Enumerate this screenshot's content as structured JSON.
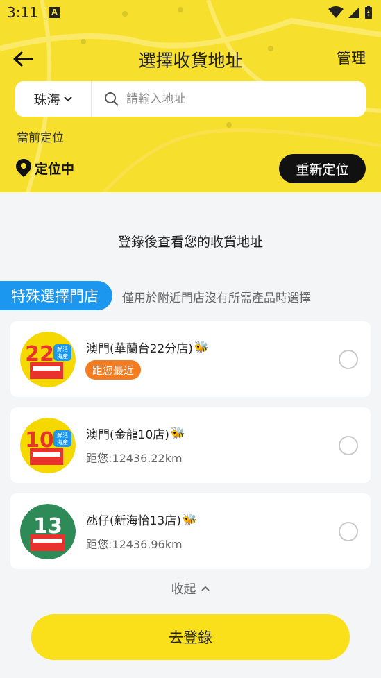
{
  "status": {
    "time": "3:11",
    "a_icon": "A"
  },
  "header": {
    "title": "選擇收貨地址",
    "manage_label": "管理"
  },
  "search": {
    "city": "珠海",
    "placeholder": "請輸入地址"
  },
  "location": {
    "section_label": "當前定位",
    "status_text": "定位中",
    "relocate_label": "重新定位"
  },
  "login_hint": "登錄後查看您的收貨地址",
  "special": {
    "tag_label": "特殊選擇門店",
    "description": "僅用於附近門店沒有所需產品時選擇"
  },
  "stores": [
    {
      "name": "澳門(華蘭台22分店)",
      "badge": "距您最近",
      "logo_number": "22",
      "logo_sub": "鮮活海產",
      "logo_color": "#f5d800"
    },
    {
      "name": "澳門(金龍10店)",
      "distance": "距您:12436.22km",
      "logo_number": "10",
      "logo_sub": "鮮活海產",
      "logo_color": "#f5d800"
    },
    {
      "name": "氹仔(新海怡13店)",
      "distance": "距您:12436.96km",
      "logo_number": "13",
      "logo_color": "#2e8b57"
    }
  ],
  "collapse_label": "收起",
  "login_button": "去登錄",
  "colors": {
    "brand_yellow": "#f7df2e",
    "special_blue": "#1b97f0",
    "badge_orange": "#f47c20"
  }
}
